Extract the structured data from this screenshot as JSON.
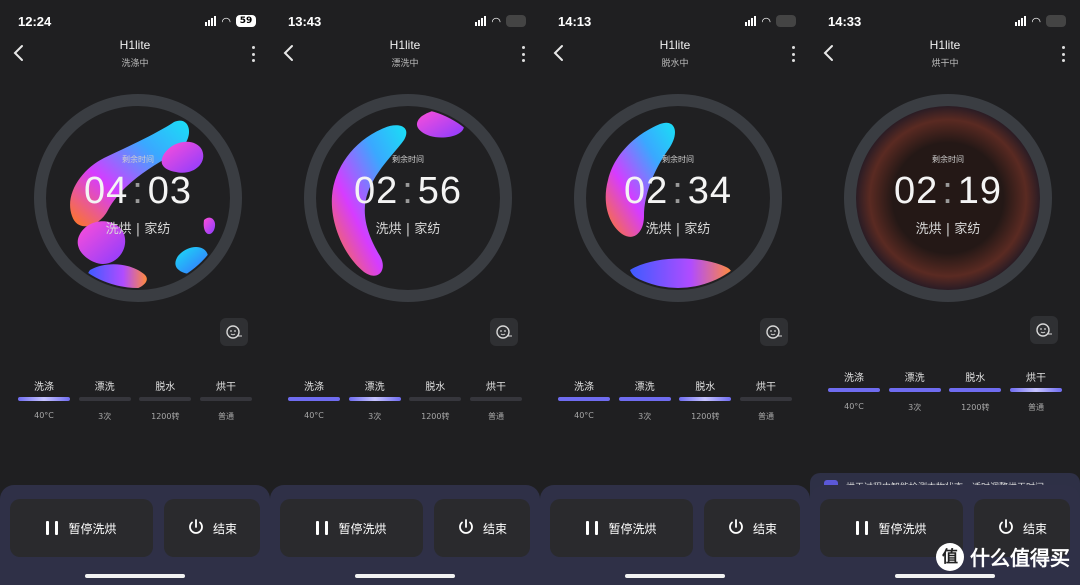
{
  "panels": [
    {
      "status_time": "12:24",
      "battery": "59",
      "title": "H1lite",
      "subtitle": "洗涤中",
      "remaining_label": "剩余时间",
      "hours": "04",
      "minutes": "03",
      "mode": "洗烘 | 家纺",
      "stages": [
        {
          "name": "洗涤",
          "value": "40°C",
          "state": "active"
        },
        {
          "name": "漂洗",
          "value": "3次",
          "state": "pending"
        },
        {
          "name": "脱水",
          "value": "1200转",
          "state": "pending"
        },
        {
          "name": "烘干",
          "value": "普通",
          "state": "pending"
        }
      ],
      "pause_label": "暂停洗烘",
      "end_label": "结束"
    },
    {
      "status_time": "13:43",
      "battery": "",
      "title": "H1lite",
      "subtitle": "漂洗中",
      "remaining_label": "剩余时间",
      "hours": "02",
      "minutes": "56",
      "mode": "洗烘 | 家纺",
      "stages": [
        {
          "name": "洗涤",
          "value": "40°C",
          "state": "done"
        },
        {
          "name": "漂洗",
          "value": "3次",
          "state": "active"
        },
        {
          "name": "脱水",
          "value": "1200转",
          "state": "pending"
        },
        {
          "name": "烘干",
          "value": "普通",
          "state": "pending"
        }
      ],
      "pause_label": "暂停洗烘",
      "end_label": "结束"
    },
    {
      "status_time": "14:13",
      "battery": "",
      "title": "H1lite",
      "subtitle": "脱水中",
      "remaining_label": "剩余时间",
      "hours": "02",
      "minutes": "34",
      "mode": "洗烘 | 家纺",
      "stages": [
        {
          "name": "洗涤",
          "value": "40°C",
          "state": "done"
        },
        {
          "name": "漂洗",
          "value": "3次",
          "state": "done"
        },
        {
          "name": "脱水",
          "value": "1200转",
          "state": "active"
        },
        {
          "name": "烘干",
          "value": "普通",
          "state": "pending"
        }
      ],
      "pause_label": "暂停洗烘",
      "end_label": "结束"
    },
    {
      "status_time": "14:33",
      "battery": "",
      "title": "H1lite",
      "subtitle": "烘干中",
      "remaining_label": "剩余时间",
      "hours": "02",
      "minutes": "19",
      "mode": "洗烘 | 家纺",
      "stages": [
        {
          "name": "洗涤",
          "value": "40°C",
          "state": "done"
        },
        {
          "name": "漂洗",
          "value": "3次",
          "state": "done"
        },
        {
          "name": "脱水",
          "value": "1200转",
          "state": "done"
        },
        {
          "name": "烘干",
          "value": "普通",
          "state": "active"
        }
      ],
      "tip": "烘干过程中智能检测衣物状态，适时调整烘干时间。",
      "pause_label": "暂停洗烘",
      "end_label": "结束"
    }
  ],
  "watermark": "什么值得买",
  "watermark_badge": "值",
  "colors": {
    "accent": "#6f6cf0",
    "ring": "#3a3d42",
    "background": "#1f1f21"
  }
}
